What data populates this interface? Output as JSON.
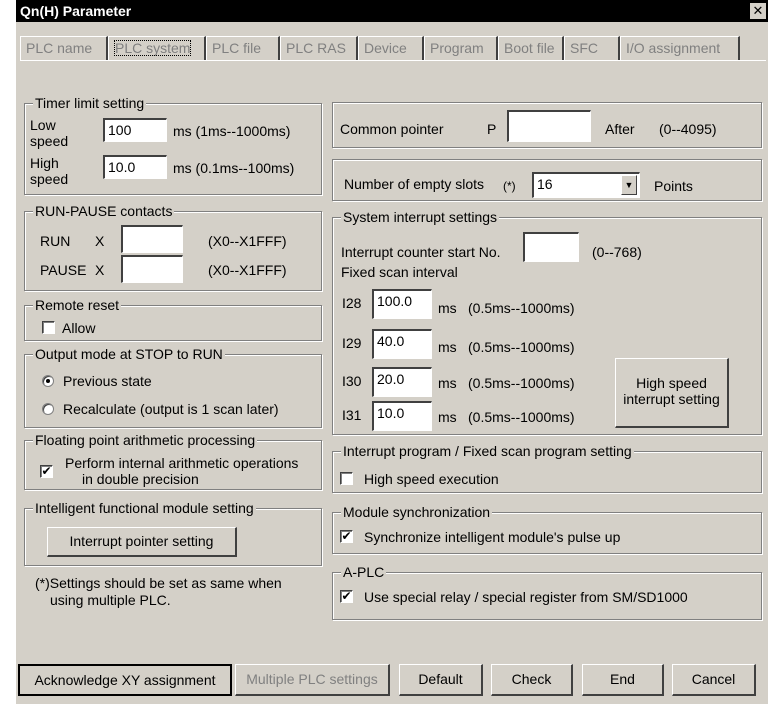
{
  "window": {
    "title": "Qn(H) Parameter",
    "close_glyph": "✕"
  },
  "tabs": [
    {
      "label": "PLC name",
      "state": "disabled"
    },
    {
      "label": "PLC system",
      "state": "active"
    },
    {
      "label": "PLC file",
      "state": "normal"
    },
    {
      "label": "PLC RAS",
      "state": "normal"
    },
    {
      "label": "Device",
      "state": "normal"
    },
    {
      "label": "Program",
      "state": "normal"
    },
    {
      "label": "Boot file",
      "state": "normal"
    },
    {
      "label": "SFC",
      "state": "normal"
    },
    {
      "label": "I/O assignment",
      "state": "normal"
    }
  ],
  "timer_limit": {
    "title": "Timer limit setting",
    "low_label": "Low\nspeed",
    "low_value": "100",
    "low_unit": "ms  (1ms--1000ms)",
    "high_label": "High\nspeed",
    "high_value": "10.0",
    "high_unit": "ms  (0.1ms--100ms)"
  },
  "run_pause": {
    "title": "RUN-PAUSE contacts",
    "run_label": "RUN",
    "pause_label": "PAUSE",
    "prefix": "X",
    "run_value": "",
    "pause_value": "",
    "range": "(X0--X1FFF)"
  },
  "remote_reset": {
    "title": "Remote reset",
    "allow_label": "Allow",
    "allow_checked": false
  },
  "output_mode": {
    "title": "Output mode at STOP to RUN",
    "option1": "Previous state",
    "option2": "Recalculate (output is 1 scan later)",
    "selected": "option1"
  },
  "floating_point": {
    "title": "Floating point arithmetic processing",
    "line1": "Perform internal arithmetic operations",
    "line2": "in double precision",
    "checked": true,
    "check_glyph": "✔"
  },
  "intelligent": {
    "title": "Intelligent functional module setting",
    "button": "Interrupt pointer setting"
  },
  "note": {
    "line1": "(*)Settings should be set as same when",
    "line2": "using multiple PLC."
  },
  "common_pointer": {
    "label": "Common pointer",
    "prefix": "P",
    "value": "",
    "after": "After",
    "range": "(0--4095)"
  },
  "empty_slots": {
    "label": "Number of empty slots",
    "star": "(*)",
    "value": "16",
    "unit": "Points",
    "arrow_glyph": "▼"
  },
  "system_interrupt": {
    "title": "System interrupt settings",
    "counter_label": "Interrupt counter start No.",
    "counter_value": "",
    "counter_range": "(0--768)",
    "fixed_scan_label": "Fixed scan interval",
    "rows": [
      {
        "id": "I28",
        "value": "100.0",
        "unit": "ms",
        "range": "(0.5ms--1000ms)"
      },
      {
        "id": "I29",
        "value": "40.0",
        "unit": "ms",
        "range": "(0.5ms--1000ms)"
      },
      {
        "id": "I30",
        "value": "20.0",
        "unit": "ms",
        "range": "(0.5ms--1000ms)"
      },
      {
        "id": "I31",
        "value": "10.0",
        "unit": "ms",
        "range": "(0.5ms--1000ms)"
      }
    ],
    "hs_button_line1": "High speed",
    "hs_button_line2": "interrupt setting"
  },
  "interrupt_program": {
    "title": "Interrupt program / Fixed scan program setting",
    "label": "High speed execution",
    "checked": false
  },
  "module_sync": {
    "title": "Module synchronization",
    "label": "Synchronize intelligent module's pulse up",
    "checked": true,
    "check_glyph": "✔"
  },
  "a_plc": {
    "title": "A-PLC",
    "label": "Use special relay / special register from SM/SD1000",
    "checked": true,
    "check_glyph": "✔"
  },
  "bottom_buttons": {
    "ack": "Acknowledge XY assignment",
    "multiple": "Multiple PLC settings",
    "default": "Default",
    "check": "Check",
    "end": "End",
    "cancel": "Cancel"
  }
}
